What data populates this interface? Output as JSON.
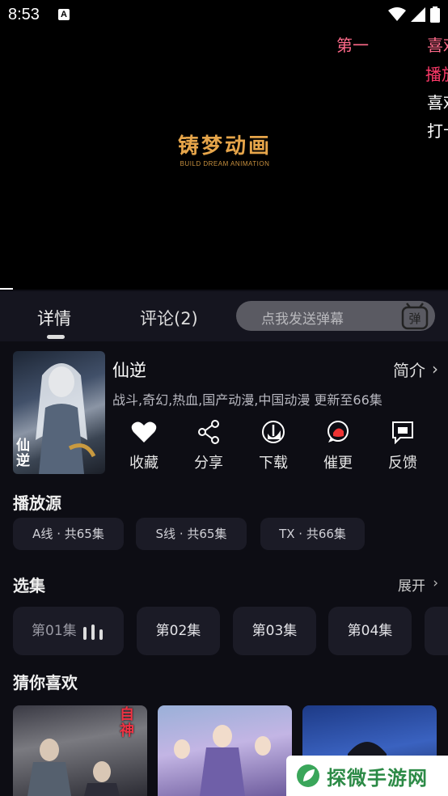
{
  "status": {
    "time": "8:53",
    "notif_icon": "A"
  },
  "video": {
    "logo_title": "铸梦动画",
    "logo_subtitle": "BUILD DREAM ANIMATION",
    "danmu": [
      {
        "text": "第一",
        "color": "#ff6a8a"
      },
      {
        "text": "喜欢",
        "color": "#ff6a8a"
      },
      {
        "text": "播放",
        "color": "#ff3a6a"
      },
      {
        "text": "喜欢",
        "color": "#ffffff"
      },
      {
        "text": "打卡",
        "color": "#ffffff"
      }
    ]
  },
  "tabs": {
    "details": "详情",
    "comments": "评论(2)"
  },
  "danmu_input": {
    "placeholder": "点我发送弹幕",
    "button": "弹"
  },
  "show": {
    "title": "仙逆",
    "intro_label": "简介",
    "tags": "战斗,奇幻,热血,国产动漫,中国动漫 更新至66集",
    "poster_text": "仙逆"
  },
  "actions": [
    {
      "label": "收藏",
      "icon": "heart-icon"
    },
    {
      "label": "分享",
      "icon": "share-icon"
    },
    {
      "label": "下载",
      "icon": "download-icon"
    },
    {
      "label": "催更",
      "icon": "remind-icon"
    },
    {
      "label": "反馈",
      "icon": "feedback-icon"
    }
  ],
  "sources": {
    "title": "播放源",
    "items": [
      "A线 · 共65集",
      "S线 · 共65集",
      "TX · 共66集"
    ]
  },
  "episodes": {
    "title": "选集",
    "expand_label": "展开",
    "items": [
      "第01集",
      "第02集",
      "第03集",
      "第04集"
    ]
  },
  "recommend": {
    "title": "猜你喜欢",
    "first_badge": "自神"
  },
  "watermark": {
    "text": "探微手游网"
  },
  "colors": {
    "accent_green": "#2c8a46",
    "danmu_pink": "#ff6a8a",
    "logo_gold": "#e6a54a"
  }
}
